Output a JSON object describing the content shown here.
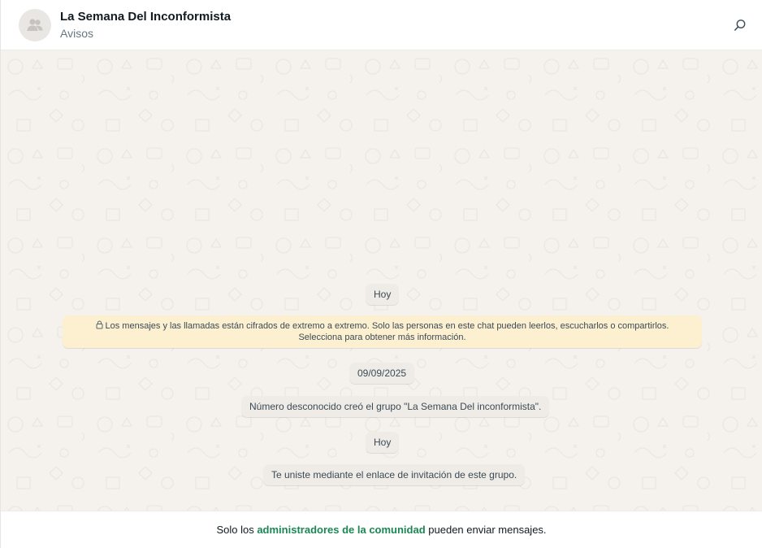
{
  "header": {
    "title": "La Semana Del Inconformista",
    "subtitle": "Avisos",
    "avatar_icon": "group-icon",
    "search_icon": "search-icon"
  },
  "chat": {
    "day_label_1": "Hoy",
    "encryption_notice": "Los mensajes y las llamadas están cifrados de extremo a extremo. Solo las personas en este chat pueden leerlos, escucharlos o compartirlos. Selecciona para obtener más información.",
    "date_label": "09/09/2025",
    "system_message_1": "Número desconocido creó el grupo \"La Semana Del inconformista\".",
    "day_label_2": "Hoy",
    "system_message_2": "Te uniste mediante el enlace de invitación de este grupo."
  },
  "footer": {
    "prefix": "Solo los",
    "link": "administradores de la comunidad",
    "suffix": "pueden enviar mensajes."
  },
  "colors": {
    "chat_background": "#f5f2ee",
    "encryption_background": "#fdf0d0",
    "link_green": "#1b8755"
  }
}
